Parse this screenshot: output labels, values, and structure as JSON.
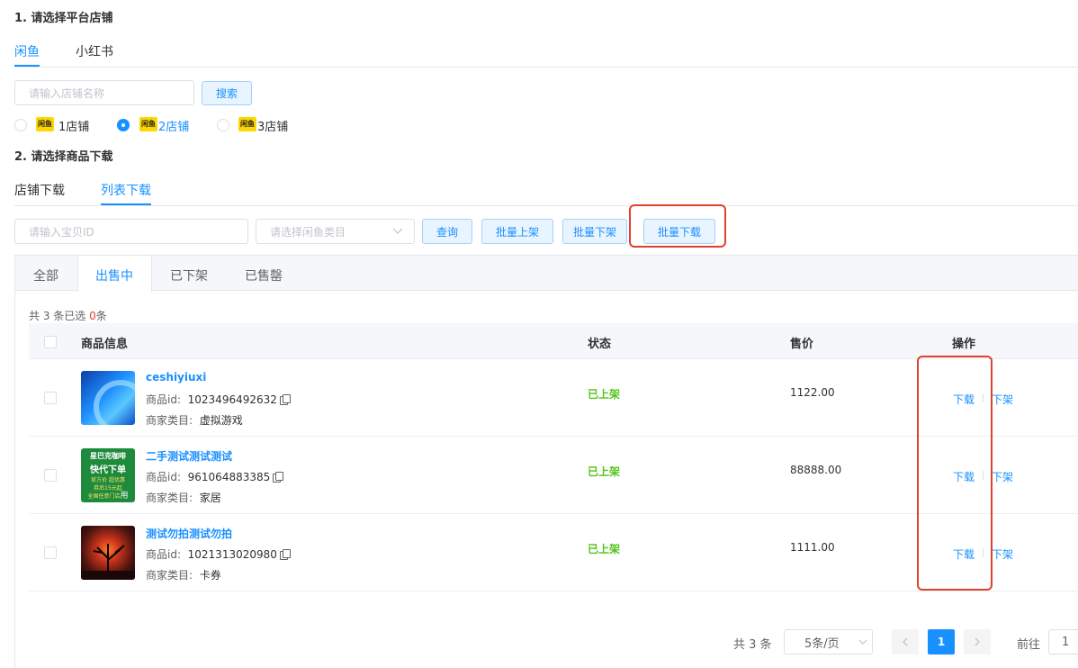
{
  "section1": {
    "title": "1. 请选择平台店铺",
    "tabs": [
      "闲鱼",
      "小红书"
    ],
    "search_placeholder": "请输入店铺名称",
    "search_button": "搜索",
    "shops": [
      {
        "logo": "闲鱼",
        "label": "1店铺",
        "checked": false
      },
      {
        "logo": "闲鱼",
        "label": "2店铺",
        "checked": true
      },
      {
        "logo": "闲鱼",
        "label": "3店铺",
        "checked": false
      }
    ]
  },
  "section2": {
    "title": "2. 请选择商品下载",
    "tabs": [
      "店铺下载",
      "列表下载"
    ],
    "id_placeholder": "请输入宝贝ID",
    "category_placeholder": "请选择闲鱼类目",
    "query_button": "查询",
    "batch_on_button": "批量上架",
    "batch_off_button": "批量下架",
    "batch_download_button": "批量下载"
  },
  "status_tabs": [
    "全部",
    "出售中",
    "已下架",
    "已售罄"
  ],
  "summary": {
    "prefix": "共 3 条已选 ",
    "count": "0",
    "suffix": "条"
  },
  "table": {
    "headers": {
      "info": "商品信息",
      "status": "状态",
      "price": "售价",
      "action": "操作"
    },
    "id_label": "商品id:",
    "category_label": "商家类目:",
    "rows": [
      {
        "name": "ceshiyiuxi",
        "id": "1023496492632",
        "category": "虚拟游戏",
        "status": "已上架",
        "price": "1122.00",
        "download": "下载",
        "delist": "下架"
      },
      {
        "name": "二手测试测试测试",
        "id": "961064883385",
        "category": "家居",
        "status": "已上架",
        "price": "88888.00",
        "download": "下载",
        "delist": "下架"
      },
      {
        "name": "测试勿拍测试勿拍",
        "id": "1021313020980",
        "category": "卡券",
        "status": "已上架",
        "price": "1111.00",
        "download": "下载",
        "delist": "下架"
      }
    ],
    "thumb2_text": {
      "line1": "星巴克咖啡",
      "line2": "快代下单",
      "line3": "官方价 超优惠",
      "line4": "券后15元起",
      "line5": "全国任意门店",
      "line6": "用"
    }
  },
  "pagination": {
    "total": "共 3 条",
    "page_size": "5条/页",
    "current_page": "1",
    "goto_label": "前往",
    "goto_value": "1"
  },
  "colors": {
    "accent": "#1890ff",
    "success": "#52c41a",
    "highlight": "#e0412f"
  }
}
